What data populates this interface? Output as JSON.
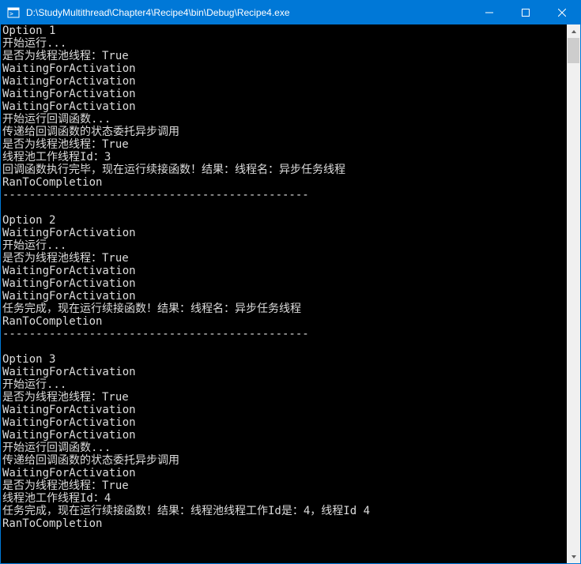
{
  "titlebar": {
    "title": "D:\\StudyMultithread\\Chapter4\\Recipe4\\bin\\Debug\\Recipe4.exe"
  },
  "console": {
    "lines": [
      "Option 1",
      "开始运行...",
      "是否为线程池线程：True",
      "WaitingForActivation",
      "WaitingForActivation",
      "WaitingForActivation",
      "WaitingForActivation",
      "开始运行回调函数...",
      "传递给回调函数的状态委托异步调用",
      "是否为线程池线程：True",
      "线程池工作线程Id：3",
      "回调函数执行完毕，现在运行续接函数！结果：线程名：异步任务线程",
      "RanToCompletion",
      "----------------------------------------------",
      "",
      "Option 2",
      "WaitingForActivation",
      "开始运行...",
      "是否为线程池线程：True",
      "WaitingForActivation",
      "WaitingForActivation",
      "WaitingForActivation",
      "任务完成，现在运行续接函数！结果：线程名：异步任务线程",
      "RanToCompletion",
      "----------------------------------------------",
      "",
      "Option 3",
      "WaitingForActivation",
      "开始运行...",
      "是否为线程池线程：True",
      "WaitingForActivation",
      "WaitingForActivation",
      "WaitingForActivation",
      "开始运行回调函数...",
      "传递给回调函数的状态委托异步调用",
      "WaitingForActivation",
      "是否为线程池线程：True",
      "线程池工作线程Id：4",
      "任务完成，现在运行续接函数！结果：线程池线程工作Id是：4，线程Id 4",
      "RanToCompletion",
      ""
    ]
  }
}
